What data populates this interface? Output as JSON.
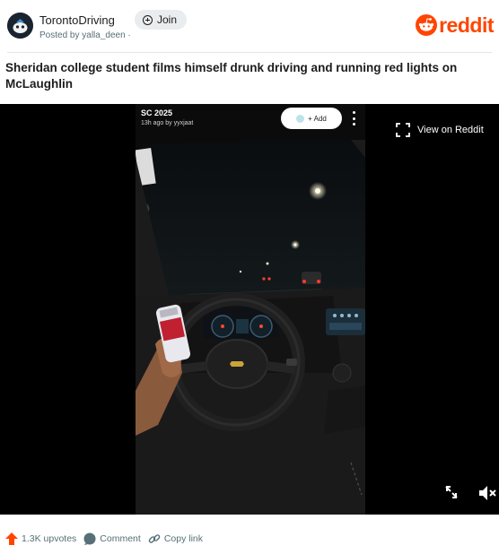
{
  "header": {
    "subreddit": "TorontoDriving",
    "posted_by": "Posted by yalla_deen ·",
    "join_label": "Join",
    "brand": "reddit",
    "brand_color": "#ff4500"
  },
  "post": {
    "title": "Sheridan college student films himself drunk driving and running red lights on McLaughlin"
  },
  "video": {
    "overlay_title": "SC 2025",
    "overlay_meta": "13h ago by yyxjaat",
    "add_label": "+ Add",
    "view_on_label": "View on Reddit",
    "icons": [
      "open-external-icon",
      "expand-icon",
      "mute-icon",
      "more-vertical-icon"
    ]
  },
  "footer": {
    "upvotes": "1.3K upvotes",
    "comment": "Comment",
    "copy_link": "Copy link",
    "icons": [
      "upvote-arrow-icon",
      "comment-bubble-icon",
      "link-icon"
    ]
  }
}
